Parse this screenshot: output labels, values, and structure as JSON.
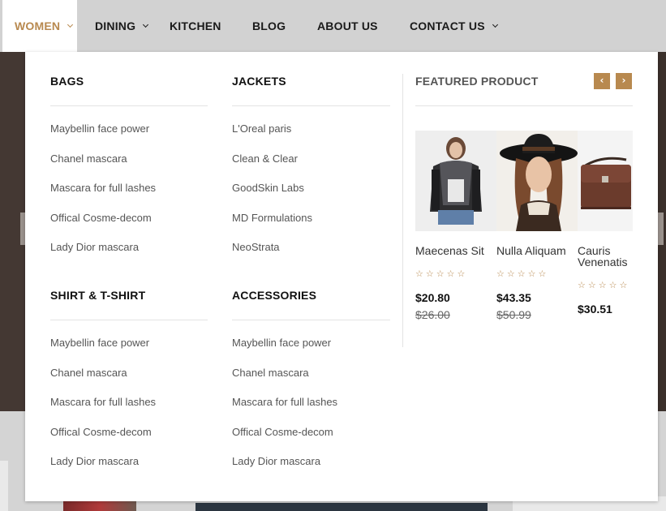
{
  "nav": {
    "items": [
      {
        "label": "WOMEN",
        "has_caret": true,
        "active": true
      },
      {
        "label": "DINING",
        "has_caret": true,
        "active": false
      },
      {
        "label": "KITCHEN",
        "has_caret": false,
        "active": false
      },
      {
        "label": "BLOG",
        "has_caret": false,
        "active": false
      },
      {
        "label": "ABOUT US",
        "has_caret": false,
        "active": false
      },
      {
        "label": "CONTACT US",
        "has_caret": true,
        "active": false
      }
    ]
  },
  "menu": {
    "columns": [
      {
        "title": "BAGS",
        "items": [
          "Maybellin face power",
          "Chanel mascara",
          "Mascara for full lashes",
          "Offical Cosme-decom",
          "Lady Dior mascara"
        ]
      },
      {
        "title": "JACKETS",
        "items": [
          "L'Oreal paris",
          "Clean & Clear",
          "GoodSkin Labs",
          "MD Formulations",
          "NeoStrata"
        ]
      },
      {
        "title": "SHIRT & T-SHIRT",
        "items": [
          "Maybellin face power",
          "Chanel mascara",
          "Mascara for full lashes",
          "Offical Cosme-decom",
          "Lady Dior mascara"
        ]
      },
      {
        "title": "ACCESSORIES",
        "items": [
          "Maybellin face power",
          "Chanel mascara",
          "Mascara for full lashes",
          "Offical Cosme-decom",
          "Lady Dior mascara"
        ]
      }
    ]
  },
  "featured": {
    "title": "FEATURED PRODUCT",
    "prev_icon": "‹",
    "next_icon": "›",
    "star_glyphs": "☆☆☆☆☆",
    "products": [
      {
        "name": "Maecenas Sit",
        "price": "$20.80",
        "old_price": "$26.00"
      },
      {
        "name": "Nulla Aliquam",
        "price": "$43.35",
        "old_price": "$50.99"
      },
      {
        "name": "Cauris Venenatis",
        "price": "$30.51",
        "old_price": ""
      }
    ]
  },
  "colors": {
    "accent": "#b8894f",
    "nav_bg": "#d2d2d2",
    "panel_bg": "#ffffff"
  }
}
